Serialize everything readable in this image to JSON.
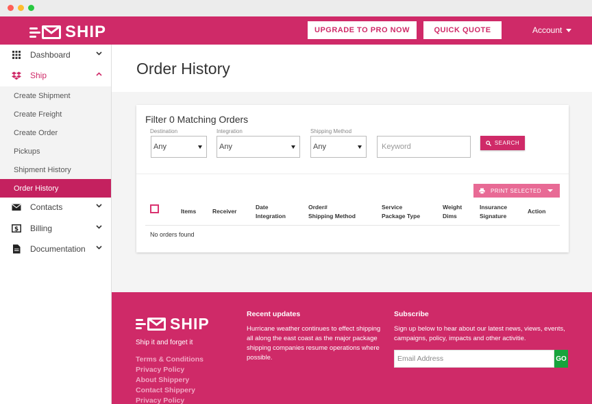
{
  "brand": {
    "name": "SHIP",
    "color": "#cf2a68"
  },
  "topbar": {
    "upgrade_label": "UPGRADE TO PRO NOW",
    "quote_label": "QUICK QUOTE",
    "account_label": "Account"
  },
  "sidebar": {
    "items": [
      {
        "label": "Dashboard",
        "icon": "grid-icon"
      },
      {
        "label": "Ship",
        "icon": "dropbox-icon"
      },
      {
        "label": "Contacts",
        "icon": "envelope-icon"
      },
      {
        "label": "Billing",
        "icon": "dollar-icon"
      },
      {
        "label": "Documentation",
        "icon": "document-icon"
      }
    ],
    "ship_sub": [
      {
        "label": "Create Shipment"
      },
      {
        "label": "Create Freight"
      },
      {
        "label": "Create Order"
      },
      {
        "label": "Pickups"
      },
      {
        "label": "Shipment History"
      },
      {
        "label": "Order History",
        "active": true
      }
    ]
  },
  "page": {
    "title": "Order History"
  },
  "filter": {
    "title": "Filter 0 Matching Orders",
    "destination_label": "Destination",
    "destination_value": "Any",
    "integration_label": "Integration",
    "integration_value": "Any",
    "method_label": "Shipping Method",
    "method_value": "Any",
    "keyword_placeholder": "Keyword",
    "search_label": "SEARCH"
  },
  "orders": {
    "print_label": "PRINT SELECTED",
    "columns": {
      "items": "Items",
      "receiver": "Receiver",
      "date": "Date",
      "integration": "Integration",
      "order_no": "Order#",
      "shipping_method": "Shipping Method",
      "service": "Service",
      "package_type": "Package Type",
      "weight": "Weight",
      "dims": "Dims",
      "insurance": "Insurance",
      "signature": "Signature",
      "action": "Action"
    },
    "empty_text": "No orders found"
  },
  "footer": {
    "tagline": "Ship it and forget it",
    "links": [
      "Terms & Conditions",
      "Privacy Policy",
      "About Shippery",
      "Contact Shippery",
      "Privacy Policy"
    ],
    "updates_title": "Recent updates",
    "updates_text": "Hurricane weather continues to effect shipping all along the east coast as the major package shipping companies resume operations where possible.",
    "subscribe_title": "Subscribe",
    "subscribe_text": "Sign up below to hear about our latest news, views, events, campaigns, policy, impacts and other activitie.",
    "email_placeholder": "Email Address",
    "go_label": "GO"
  }
}
